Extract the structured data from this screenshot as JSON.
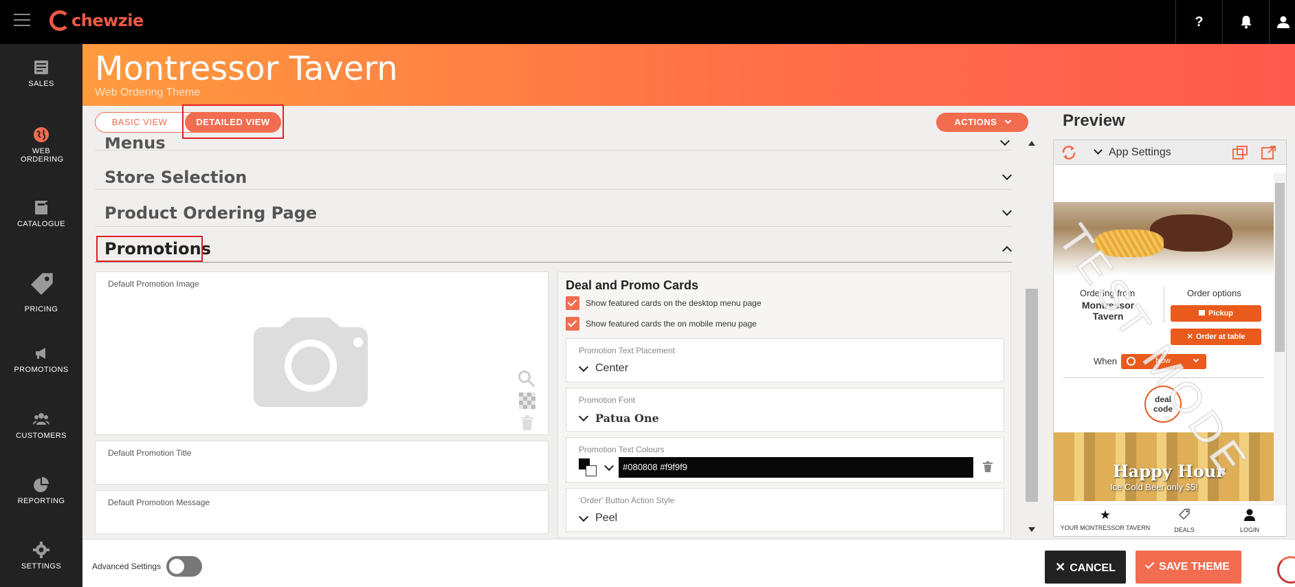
{
  "app": {
    "name": "chewzie"
  },
  "topbar": {
    "help_icon_label": "?"
  },
  "sidebar": {
    "items": [
      {
        "label": "SALES",
        "icon": "sales-icon"
      },
      {
        "label": "WEB ORDERING",
        "icon": "globe-icon"
      },
      {
        "label": "CATALOGUE",
        "icon": "catalogue-icon"
      },
      {
        "label": "PRICING",
        "icon": "tag-icon"
      },
      {
        "label": "PROMOTIONS",
        "icon": "megaphone-icon"
      },
      {
        "label": "CUSTOMERS",
        "icon": "users-icon"
      },
      {
        "label": "REPORTING",
        "icon": "pie-chart-icon"
      },
      {
        "label": "SETTINGS",
        "icon": "gear-icon"
      }
    ]
  },
  "header": {
    "title": "Montressor Tavern",
    "subtitle": "Web Ordering Theme"
  },
  "view_toggle": {
    "basic": "BASIC VIEW",
    "detailed": "DETAILED VIEW"
  },
  "actions_label": "ACTIONS",
  "sections": {
    "menus": "Menus",
    "store_selection": "Store Selection",
    "product_ordering": "Product Ordering Page",
    "promotions": "Promotions"
  },
  "promotions": {
    "default_image_label": "Default Promotion Image",
    "default_title_label": "Default Promotion Title",
    "default_message_label": "Default Promotion Message",
    "cards_heading": "Deal and Promo Cards",
    "checkbox_desktop": "Show featured cards on the desktop menu page",
    "checkbox_mobile": "Show featured cards the on mobile menu page",
    "text_placement_label": "Promotion Text Placement",
    "text_placement_value": "Center",
    "font_label": "Promotion Font",
    "font_value": "Patua One",
    "text_colours_label": "Promotion Text Colours",
    "text_colours_value": "#080808 #f9f9f9",
    "order_button_label": "'Order' Button Action Style",
    "order_button_value": "Peel"
  },
  "preview": {
    "title": "Preview",
    "dropdown": "App Settings",
    "ordering_from": "Ordering from",
    "store_name": "Montressor Tavern",
    "order_options": "Order options",
    "pickup": "Pickup",
    "order_at_table": "Order at table",
    "when": "When",
    "when_value": "Now",
    "deal_code": "deal code",
    "banner_title": "Happy Hour",
    "banner_sub": "Ice Cold Beer only $5!",
    "watermark": "TEST MODE",
    "nav_home": "YOUR MONTRESSOR TAVERN",
    "nav_deals": "DEALS",
    "nav_login": "LOGIN"
  },
  "bottom": {
    "advanced_label": "Advanced Settings",
    "advanced_enabled": false,
    "cancel": "CANCEL",
    "save": "SAVE THEME"
  },
  "colors": {
    "accent": "#f26c4f",
    "header_start": "#ff9a3e",
    "header_end": "#ff5a4f",
    "sidebar": "#222222"
  }
}
